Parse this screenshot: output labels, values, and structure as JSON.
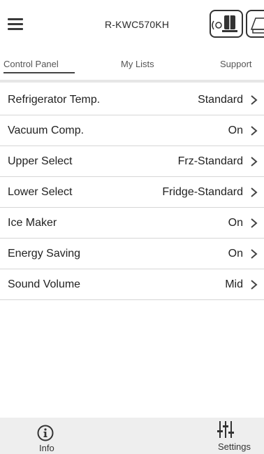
{
  "header": {
    "title": "R-KWC570KH",
    "menu_icon": "hamburger-menu-icon",
    "appliance_icon": "refrigerator-remote-icon",
    "appliance_icon_2": "appliance-icon"
  },
  "tabs": [
    {
      "label": "Control Panel",
      "active": true
    },
    {
      "label": "My Lists",
      "active": false
    },
    {
      "label": "Support",
      "active": false
    }
  ],
  "settings": [
    {
      "label": "Refrigerator Temp.",
      "value": "Standard"
    },
    {
      "label": "Vacuum Comp.",
      "value": "On"
    },
    {
      "label": "Upper Select",
      "value": "Frz-Standard"
    },
    {
      "label": "Lower Select",
      "value": "Fridge-Standard"
    },
    {
      "label": "Ice Maker",
      "value": "On"
    },
    {
      "label": "Energy Saving",
      "value": "On"
    },
    {
      "label": "Sound Volume",
      "value": "Mid"
    }
  ],
  "bottom_bar": {
    "info_label": "Info",
    "settings_label": "Settings",
    "info_icon": "info-circle-icon",
    "settings_icon": "sliders-icon"
  },
  "colors": {
    "background": "#ffffff",
    "bottom_bar": "#eeeeee",
    "divider": "#d6d6d6",
    "text": "#222222"
  }
}
